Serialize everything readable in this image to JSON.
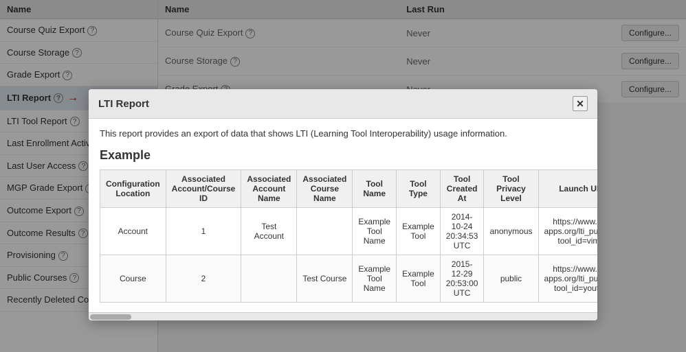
{
  "sidebar": {
    "column_header": "Name",
    "items": [
      {
        "id": "course-quiz-export",
        "label": "Course Quiz Export",
        "has_help": true,
        "active": false
      },
      {
        "id": "course-storage",
        "label": "Course Storage",
        "has_help": true,
        "active": false
      },
      {
        "id": "grade-export",
        "label": "Grade Export",
        "has_help": true,
        "active": false
      },
      {
        "id": "lti-report",
        "label": "LTI Report",
        "has_help": true,
        "active": true,
        "has_arrow": true
      },
      {
        "id": "lti-tool-report",
        "label": "LTI Tool Report",
        "has_help": true,
        "active": false
      },
      {
        "id": "last-enrollment-activity",
        "label": "Last Enrollment Activity",
        "has_help": true,
        "active": false
      },
      {
        "id": "last-user-access",
        "label": "Last User Access",
        "has_help": true,
        "active": false
      },
      {
        "id": "mgp-grade-export",
        "label": "MGP Grade Export",
        "has_help": true,
        "active": false
      },
      {
        "id": "outcome-export",
        "label": "Outcome Export",
        "has_help": true,
        "active": false
      },
      {
        "id": "outcome-results",
        "label": "Outcome Results",
        "has_help": true,
        "active": false
      },
      {
        "id": "provisioning",
        "label": "Provisioning",
        "has_help": true,
        "active": false
      },
      {
        "id": "public-courses",
        "label": "Public Courses",
        "has_help": true,
        "active": false
      },
      {
        "id": "recently-deleted-courses",
        "label": "Recently Deleted Courses",
        "has_help": true,
        "active": false
      }
    ]
  },
  "main_table": {
    "headers": [
      "Name",
      "Last Run"
    ],
    "rows": [
      {
        "name": "Course Quiz Export",
        "last_run": "Never",
        "has_configure": true
      },
      {
        "name": "Course Storage",
        "last_run": "Never",
        "has_configure": true
      },
      {
        "name": "Grade Export",
        "last_run": "Never",
        "has_configure": true
      }
    ],
    "configure_label": "Configure..."
  },
  "modal": {
    "title": "LTI Report",
    "close_label": "✕",
    "description": "This report provides an export of data that shows LTI (Learning Tool Interoperability) usage information.",
    "example_heading": "Example",
    "table": {
      "headers": [
        "Configuration Location",
        "Associated Account/Course ID",
        "Associated Account Name",
        "Associated Course Name",
        "Tool Name",
        "Tool Type",
        "Tool Created At",
        "Tool Privacy Level",
        "Launch URL"
      ],
      "rows": [
        {
          "configuration_location": "Account",
          "associated_account_course_id": "1",
          "associated_account_name": "Test Account",
          "associated_course_name": "",
          "tool_name": "Example Tool Name",
          "tool_type": "Example Tool",
          "tool_created_at": "2014-10-24 20:34:53 UTC",
          "tool_privacy_level": "anonymous",
          "launch_url": "https://www.edu-apps.org/lti_public_re tool_id=vimeo"
        },
        {
          "configuration_location": "Course",
          "associated_account_course_id": "2",
          "associated_account_name": "",
          "associated_course_name": "Test Course",
          "tool_name": "Example Tool Name",
          "tool_type": "Example Tool",
          "tool_created_at": "2015-12-29 20:53:00 UTC",
          "tool_privacy_level": "public",
          "launch_url": "https://www.edu-apps.org/lti_public_re tool_id=youtube"
        }
      ]
    }
  }
}
